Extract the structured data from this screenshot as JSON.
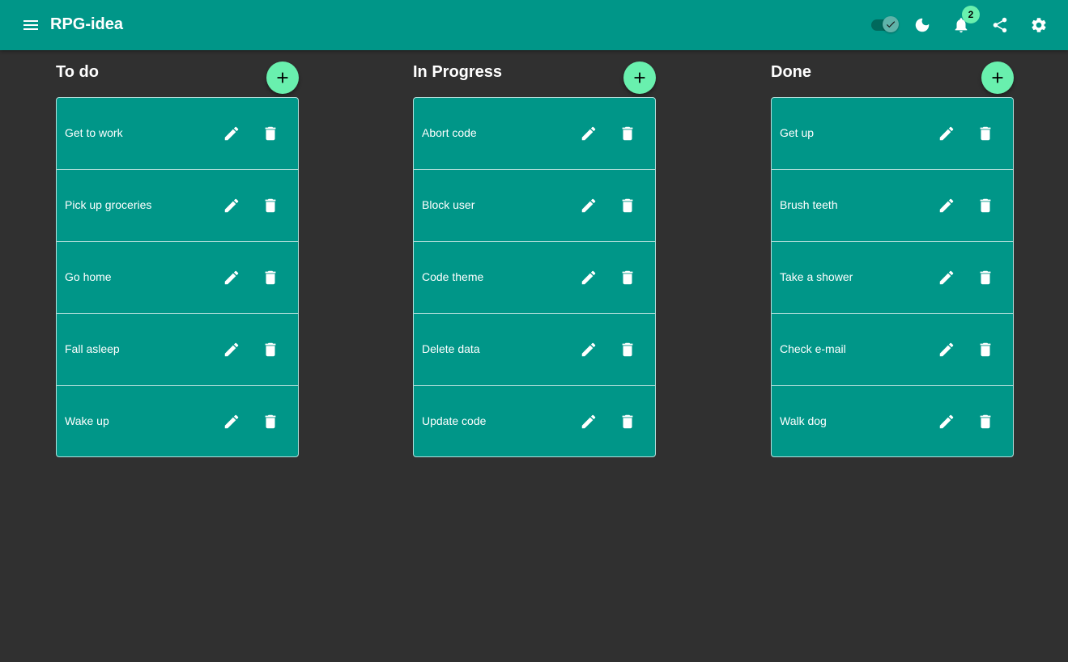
{
  "app": {
    "title": "RPG-idea",
    "notification_count": "2",
    "theme_toggle_checked": true
  },
  "icons": {
    "menu": "menu-icon",
    "toggle": "check-icon",
    "theme": "moon-icon",
    "notifications": "bell-icon",
    "share": "share-icon",
    "settings": "gear-icon",
    "add": "plus-icon",
    "edit": "pencil-icon",
    "delete": "trash-icon"
  },
  "colors": {
    "primary": "#009688",
    "accent": "#69f0ae",
    "background": "#303030",
    "border": "#b2dfdb"
  },
  "columns": [
    {
      "title": "To do",
      "items": [
        "Get to work",
        "Pick up groceries",
        "Go home",
        "Fall asleep",
        "Wake up"
      ]
    },
    {
      "title": "In Progress",
      "items": [
        "Abort code",
        "Block user",
        "Code theme",
        "Delete data",
        "Update code"
      ]
    },
    {
      "title": "Done",
      "items": [
        "Get up",
        "Brush teeth",
        "Take a shower",
        "Check e-mail",
        "Walk dog"
      ]
    }
  ]
}
